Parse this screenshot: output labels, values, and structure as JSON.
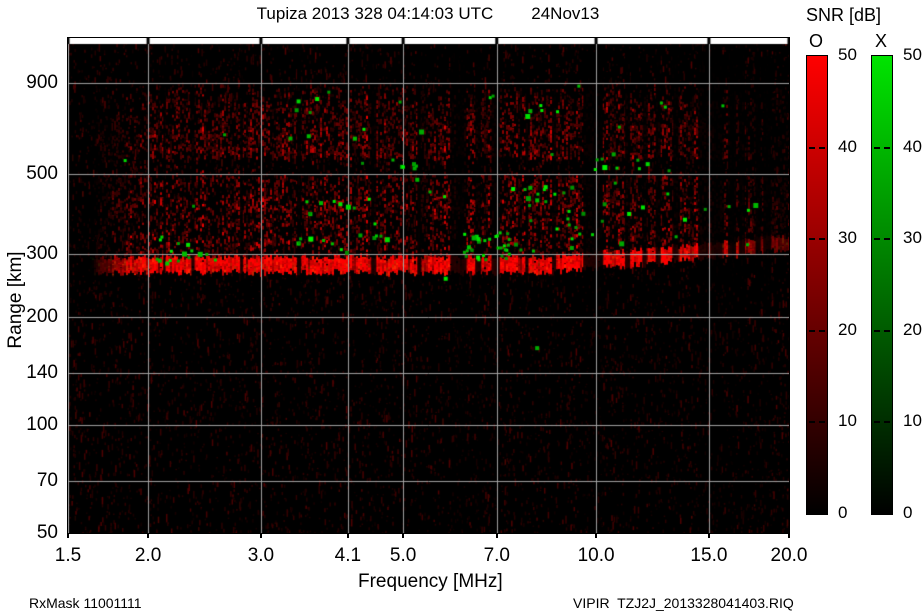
{
  "header": {
    "title": "Tupiza 2013 328 04:14:03 UTC",
    "date_label": "24Nov13"
  },
  "axes": {
    "x_label": "Frequency [MHz]",
    "y_label": "Range [km]",
    "x_ticks": [
      {
        "label": "1.5",
        "value": 1.5
      },
      {
        "label": "2.0",
        "value": 2.0
      },
      {
        "label": "3.0",
        "value": 3.0
      },
      {
        "label": "4.1",
        "value": 4.1
      },
      {
        "label": "5.0",
        "value": 5.0
      },
      {
        "label": "7.0",
        "value": 7.0
      },
      {
        "label": "10.0",
        "value": 10.0
      },
      {
        "label": "15.0",
        "value": 15.0
      },
      {
        "label": "20.0",
        "value": 20.0
      }
    ],
    "y_ticks": [
      {
        "label": "50",
        "value": 50
      },
      {
        "label": "70",
        "value": 70
      },
      {
        "label": "100",
        "value": 100
      },
      {
        "label": "140",
        "value": 140
      },
      {
        "label": "200",
        "value": 200
      },
      {
        "label": "300",
        "value": 300
      },
      {
        "label": "500",
        "value": 500
      },
      {
        "label": "900",
        "value": 900
      }
    ]
  },
  "colorbars": {
    "title": "SNR [dB]",
    "min": 0,
    "max": 50,
    "tick_labels": [
      "0",
      "10",
      "20",
      "30",
      "40",
      "50"
    ],
    "o": {
      "label": "O",
      "top_color": "#ff0000"
    },
    "x": {
      "label": "X",
      "top_color": "#00e400"
    }
  },
  "footer": {
    "left": "RxMask 11001111",
    "right": "VIPIR  TZJ2J_2013328041403.RIQ"
  },
  "chart_data": {
    "type": "heatmap",
    "title": "Tupiza 2013 328 04:14:03 UTC",
    "date_label": "24Nov13",
    "xlabel": "Frequency [MHz]",
    "ylabel": "Range [km]",
    "x_scale": "log",
    "x_range": [
      1.5,
      20
    ],
    "x_tick_values": [
      1.5,
      2.0,
      3.0,
      4.1,
      5.0,
      7.0,
      10.0,
      15.0,
      20.0
    ],
    "y_scale": "log",
    "y_range": [
      50,
      1200
    ],
    "y_tick_values": [
      50,
      70,
      100,
      140,
      200,
      300,
      500,
      900
    ],
    "value_label": "SNR [dB]",
    "value_range": [
      0,
      50
    ],
    "grid": true,
    "gridline_color": "#a8a8a8",
    "background": "#000000",
    "o_mode_color_max": "#ff0000",
    "x_mode_color_max": "#00e400",
    "description": "Night-time ionogram dominated by strong spread-F O-mode echoes (red) from ~270 km up to ~900 km virtual range across 1.7-20 MHz; brightest leading edge near 270-300 km rising slightly with frequency; diffuse upper layer 560-880 km; scattered X-mode echoes (green specks) mostly 280-500 km between 2 and 13 MHz; strong vertical striping and RFI dropout notches; black noise background below the leading edge.",
    "echo_layers": [
      {
        "name": "F-region leading edge",
        "f_mhz": [
          1.7,
          20
        ],
        "range_km": [
          270,
          300
        ],
        "snr_db": [
          35,
          50
        ]
      },
      {
        "name": "spread-F main body",
        "f_mhz": [
          1.7,
          20
        ],
        "range_km": [
          300,
          500
        ],
        "snr_db": [
          15,
          35
        ]
      },
      {
        "name": "upper spread layer",
        "f_mhz": [
          1.8,
          14
        ],
        "range_km": [
          560,
          880
        ],
        "snr_db": [
          10,
          25
        ]
      },
      {
        "name": "background noise",
        "f_mhz": [
          1.5,
          20
        ],
        "range_km": [
          50,
          1200
        ],
        "snr_db": [
          0,
          8
        ]
      }
    ],
    "rfi_notches": [
      [
        2.12,
        2
      ],
      [
        2.35,
        3
      ],
      [
        2.8,
        3
      ],
      [
        3.44,
        4
      ],
      [
        4.5,
        5
      ],
      [
        5.3,
        4
      ],
      [
        6.1,
        16
      ],
      [
        6.55,
        6
      ],
      [
        6.97,
        8
      ],
      [
        7.8,
        3
      ],
      [
        8.6,
        4
      ],
      [
        9.9,
        20
      ],
      [
        11.2,
        5
      ],
      [
        11.9,
        4
      ],
      [
        12.5,
        5
      ],
      [
        13.3,
        6
      ],
      [
        14.7,
        10
      ],
      [
        15.4,
        12
      ],
      [
        16.3,
        8
      ],
      [
        16.9,
        6
      ],
      [
        17.9,
        5
      ],
      [
        18.5,
        8
      ]
    ],
    "x_mode_clusters": [
      {
        "f_mhz": [
          2.05,
          2.75
        ],
        "range_km": [
          280,
          340
        ],
        "count": 16
      },
      {
        "f_mhz": [
          3.4,
          4.8
        ],
        "range_km": [
          290,
          430
        ],
        "count": 22
      },
      {
        "f_mhz": [
          6.2,
          7.35
        ],
        "range_km": [
          280,
          345
        ],
        "count": 30
      },
      {
        "f_mhz": [
          7.4,
          9.6
        ],
        "range_km": [
          300,
          470
        ],
        "count": 26
      },
      {
        "f_mhz": [
          9.8,
          13.5
        ],
        "range_km": [
          300,
          560
        ],
        "count": 16
      },
      {
        "f_mhz": [
          2.0,
          13.0
        ],
        "range_km": [
          560,
          900
        ],
        "count": 22
      },
      {
        "f_mhz": [
          4.0,
          6.0
        ],
        "range_km": [
          430,
          600
        ],
        "count": 10
      },
      {
        "f_mhz": [
          13.5,
          19.0
        ],
        "range_km": [
          300,
          420
        ],
        "count": 6
      },
      {
        "f_mhz": [
          1.8,
          19.0
        ],
        "range_km": [
          60,
          900
        ],
        "count": 12
      }
    ]
  }
}
